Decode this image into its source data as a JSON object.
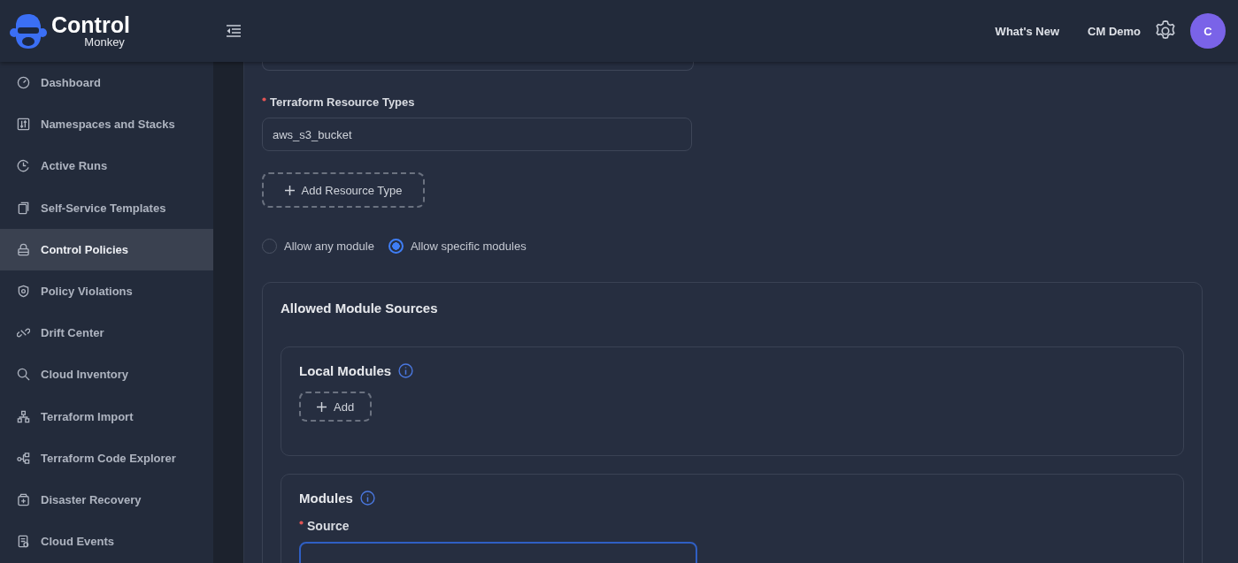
{
  "header": {
    "logo_title": "Control",
    "logo_subtitle": "Monkey",
    "links": [
      "What's New",
      "CM Demo"
    ],
    "avatar": "C"
  },
  "sidebar": {
    "items": [
      {
        "label": "Dashboard",
        "selected": false
      },
      {
        "label": "Namespaces and Stacks",
        "selected": false
      },
      {
        "label": "Active Runs",
        "selected": false
      },
      {
        "label": "Self-Service Templates",
        "selected": false
      },
      {
        "label": "Control Policies",
        "selected": true
      },
      {
        "label": "Policy Violations",
        "selected": false
      },
      {
        "label": "Drift Center",
        "selected": false
      },
      {
        "label": "Cloud Inventory",
        "selected": false
      },
      {
        "label": "Terraform Import",
        "selected": false
      },
      {
        "label": "Terraform Code Explorer",
        "selected": false
      },
      {
        "label": "Disaster Recovery",
        "selected": false
      },
      {
        "label": "Cloud Events",
        "selected": false
      }
    ]
  },
  "form": {
    "resource_types": {
      "label": "Terraform Resource Types",
      "required": true,
      "value": "aws_s3_bucket"
    },
    "add_resource_button": "Add Resource Type",
    "module_options": [
      {
        "label": "Allow any module",
        "selected": false
      },
      {
        "label": "Allow specific modules",
        "selected": true
      }
    ],
    "allowed_sources": {
      "title": "Allowed Module Sources",
      "local_modules": {
        "title": "Local Modules",
        "add_button": "Add"
      },
      "modules": {
        "title": "Modules",
        "source_label": "Source",
        "source_required": true
      }
    }
  }
}
